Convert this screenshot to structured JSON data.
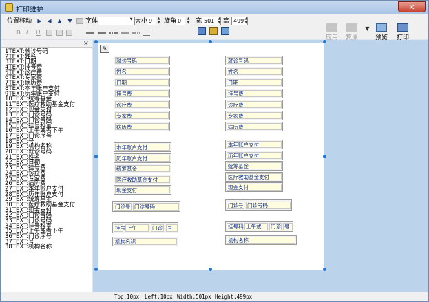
{
  "window": {
    "title": "打印维护",
    "close_glyph": "✕"
  },
  "toolbar": {
    "position_label": "位置移动",
    "font_label": "字体",
    "font_value": "",
    "size_label": "大小",
    "size_value": "9",
    "rotate_label": "旋角",
    "rotate_value": "0",
    "width_label": "宽",
    "width_value": "501",
    "height_label": "高",
    "height_value": "499",
    "bold": "B",
    "italic": "I",
    "underline": "U",
    "apply_label": "应用",
    "restore_label": "复原",
    "preview_label": "预览",
    "print_label": "打印"
  },
  "field_list": [
    "1TEXT:就诊号码",
    "2TEXT:姓名",
    "3TEXT:日期",
    "4TEXT:挂号费",
    "5TEXT:诊疗费",
    "6TEXT:专家费",
    "7TEXT:病历费",
    "8TEXT:本年账户支付",
    "9TEXT:历年账户支付",
    "10TEXT:统筹基金",
    "11TEXT:医疗救助基金支付",
    "12TEXT:现金支付",
    "13TEXT:门诊号码",
    "14TEXT:门诊号码",
    "15TEXT:挂号科室",
    "16TEXT:上午或者下午",
    "17TEXT:门诊序号",
    "18TEXT:号",
    "19TEXT:机构名称",
    "20TEXT:就诊号码",
    "21TEXT:姓名",
    "22TEXT:日期",
    "23TEXT:挂号费",
    "24TEXT:诊疗费",
    "25TEXT:专家费",
    "26TEXT:病历费",
    "27TEXT:本年账户支付",
    "28TEXT:历年账户支付",
    "29TEXT:统筹基金",
    "30TEXT:医疗救助基金支付",
    "31TEXT:现金支付",
    "32TEXT:门诊号码",
    "33TEXT:门诊号码",
    "34TEXT:挂号科室",
    "35TEXT:上午或者下午",
    "36TEXT:门诊序号",
    "37TEXT:号",
    "38TEXT:机构名称"
  ],
  "left_block1": [
    "就诊号码",
    "姓名",
    "日期",
    "挂号费",
    "诊疗费",
    "专家费",
    "病历费"
  ],
  "right_block1": [
    "就诊号码",
    "姓名",
    "日期",
    "挂号费",
    "诊疗费",
    "专家费",
    "病历费"
  ],
  "left_block2": [
    "本年账户支付",
    "历年账户支付",
    "统筹基金",
    "医疗救助基金支付",
    "现金支付"
  ],
  "right_block2": [
    "本年账户支付",
    "历年账户支付",
    "统筹基金",
    "医疗救助基金支付",
    "现金支付"
  ],
  "left_clinic": [
    "门诊号",
    "门诊号码"
  ],
  "right_clinic": [
    "门诊号",
    "门诊号码"
  ],
  "left_reg": [
    "挂号科",
    "上午",
    "门诊",
    "号"
  ],
  "right_reg": [
    "挂号科",
    "上午或",
    "门诊",
    "号"
  ],
  "left_org": "机构名称",
  "right_org": "机构名称",
  "status": {
    "top": "Top:10px",
    "left": "Left:10px",
    "width": "Width:501px",
    "height": "Height:499px"
  }
}
